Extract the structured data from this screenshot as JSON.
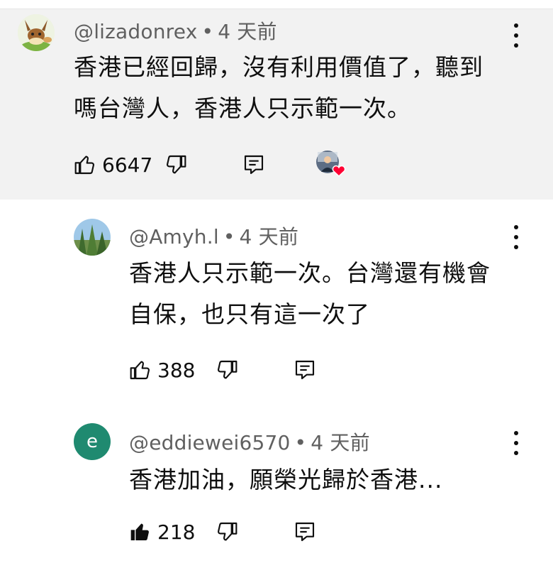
{
  "comments": [
    {
      "handle": "@lizadonrex",
      "dot": "•",
      "time": "4 天前",
      "line1": "香港已經回歸，沒有利用價值了，聽到",
      "line2": "嗎台灣人，香港人只示範一次。",
      "likes": "6647",
      "liked": false,
      "avatar": "eevee-avatar",
      "creator_heart": true
    },
    {
      "handle": "@Amyh.l",
      "dot": "•",
      "time": "4 天前",
      "line1": "香港人只示範一次。台灣還有機會",
      "line2": "自保，也只有這一次了",
      "likes": "388",
      "liked": false,
      "avatar": "forest-avatar"
    },
    {
      "handle": "@eddiewei6570",
      "dot": "•",
      "time": "4 天前",
      "line1": "香港加油，願榮光歸於香港...",
      "likes": "218",
      "liked": true,
      "avatar_letter": "e",
      "avatar_color": "#1f8a70"
    }
  ],
  "icons": {
    "like": "thumbs-up-icon",
    "dislike": "thumbs-down-icon",
    "reply": "reply-icon",
    "more": "more-vertical-icon"
  }
}
